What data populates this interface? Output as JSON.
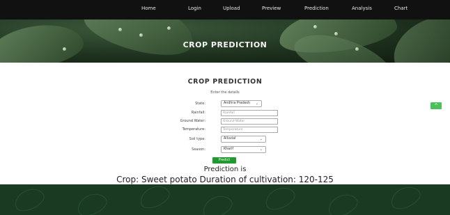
{
  "nav": {
    "items": [
      "Home",
      "Login",
      "Upload",
      "Preview",
      "Prediction",
      "Analysis",
      "Chart"
    ]
  },
  "hero": {
    "title": "CROP PREDICTION"
  },
  "form": {
    "title": "CROP PREDICTION",
    "subtitle": "Enter the details",
    "state": {
      "label": "State:",
      "value": "Andhra Pradesh"
    },
    "rainfall": {
      "label": "Rainfall:",
      "placeholder": "Rainfall"
    },
    "groundwater": {
      "label": "Ground Water:",
      "placeholder": "Ground Water"
    },
    "temperature": {
      "label": "Temperature:",
      "placeholder": "Temperature"
    },
    "soil": {
      "label": "Soil type:",
      "value": "Alluvial"
    },
    "season": {
      "label": "Season:",
      "value": "Kharif"
    },
    "predict_label": "Predict"
  },
  "result": {
    "label": "Prediction is",
    "text": "Crop: Sweet potato Duration of cultivation: 120-125"
  },
  "scroll_top": {
    "icon": "chevron-up-icon",
    "glyph": "^"
  },
  "colors": {
    "nav_bg": "#111111",
    "button": "#1f9a2e",
    "scroll_button": "#4cc05a",
    "footer": "#1a3a22"
  }
}
